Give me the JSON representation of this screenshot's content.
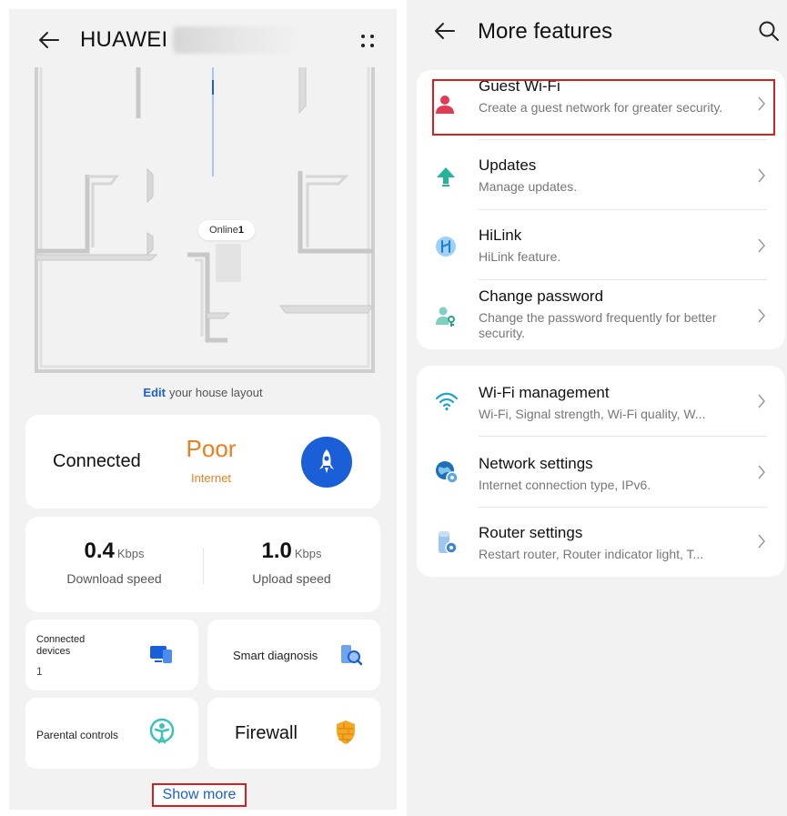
{
  "left": {
    "header": {
      "title": "HUAWEI",
      "back_icon": "back-arrow-icon",
      "menu_icon": "more-dots-icon"
    },
    "map": {
      "online_label": "Online",
      "online_count": "1",
      "edit_link": "Edit",
      "edit_suffix": "your house layout"
    },
    "status": {
      "connection": "Connected",
      "quality": "Poor",
      "quality_sub": "Internet",
      "quality_color": "#ef7d1f",
      "action_icon": "rocket-icon",
      "action_color": "#1a5ed8"
    },
    "speed": {
      "download_value": "0.4",
      "download_unit": "Kbps",
      "download_label": "Download speed",
      "upload_value": "1.0",
      "upload_unit": "Kbps",
      "upload_label": "Upload speed"
    },
    "tiles": {
      "devices_label": "Connected devices",
      "devices_count": "1",
      "devices_icon": "devices-icon",
      "diagnosis_label": "Smart diagnosis",
      "diagnosis_icon": "diagnosis-icon",
      "parental_label": "Parental controls",
      "parental_icon": "parental-controls-icon",
      "firewall_label": "Firewall",
      "firewall_icon": "firewall-icon"
    },
    "show_more": "Show more"
  },
  "right": {
    "header": {
      "title": "More features",
      "back_icon": "back-arrow-icon",
      "search_icon": "search-icon"
    },
    "group1": [
      {
        "title": "Guest Wi-Fi",
        "subtitle": "Create a guest network for greater security.",
        "icon": "guest-user-icon"
      },
      {
        "title": "Updates",
        "subtitle": "Manage updates.",
        "icon": "update-arrow-icon"
      },
      {
        "title": "HiLink",
        "subtitle": "HiLink feature.",
        "icon": "hilink-icon"
      },
      {
        "title": "Change password",
        "subtitle": "Change the password frequently for better security.",
        "icon": "password-user-icon"
      }
    ],
    "group2": [
      {
        "title": "Wi-Fi management",
        "subtitle": "Wi-Fi, Signal strength, Wi-Fi quality, W...",
        "icon": "wifi-icon"
      },
      {
        "title": "Network settings",
        "subtitle": "Internet connection type, IPv6.",
        "icon": "globe-settings-icon"
      },
      {
        "title": "Router settings",
        "subtitle": "Restart router, Router indicator light, T...",
        "icon": "router-settings-icon"
      }
    ]
  },
  "colors": {
    "highlight": "#d42020",
    "link": "#1a5ed8",
    "background": "#f2f2f2"
  }
}
